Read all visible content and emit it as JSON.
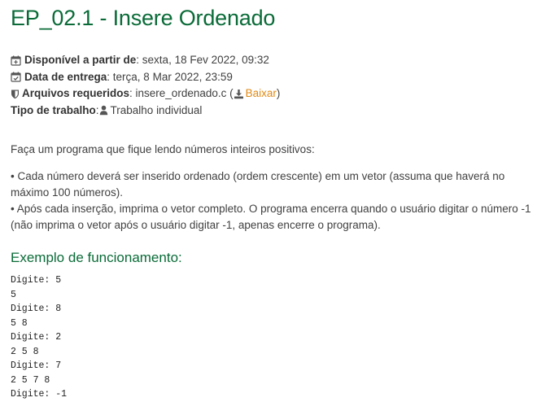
{
  "title": "EP_02.1 - Insere Ordenado",
  "meta": {
    "available_label": "Disponível a partir de",
    "available_value": ": sexta, 18 Fev 2022, 09:32",
    "due_label": "Data de entrega",
    "due_value": ": terça, 8 Mar 2022, 23:59",
    "files_label": "Arquivos requeridos",
    "files_value": ": insere_ordenado.c (",
    "download_label": "Baixar",
    "files_close": ")",
    "work_type_label": "Tipo de trabalho",
    "work_type_sep": ": ",
    "work_type_value": "Trabalho individual"
  },
  "icons": {
    "available": "calendar-plus-icon",
    "due": "calendar-check-icon",
    "files": "shield-icon",
    "download": "download-icon",
    "work_type": "user-icon"
  },
  "colors": {
    "heading_green": "#0a6b38",
    "link_orange": "#e08a14"
  },
  "description": {
    "intro": "Faça um programa que fique lendo números inteiros positivos:",
    "bullet1": "• Cada número deverá ser inserido ordenado (ordem crescente) em um vetor (assuma que haverá no máximo 100 números).",
    "bullet2": "• Após cada inserção, imprima o vetor completo. O programa encerra quando o usuário digitar o número -1 (não imprima o vetor após o usuário digitar -1, apenas encerre o programa)."
  },
  "example": {
    "heading": "Exemplo de funcionamento:",
    "lines": [
      "Digite: 5",
      "5",
      "Digite: 8",
      "5 8",
      "Digite: 2",
      "2 5 8",
      "Digite: 7",
      "2 5 7 8",
      "Digite: -1"
    ]
  }
}
